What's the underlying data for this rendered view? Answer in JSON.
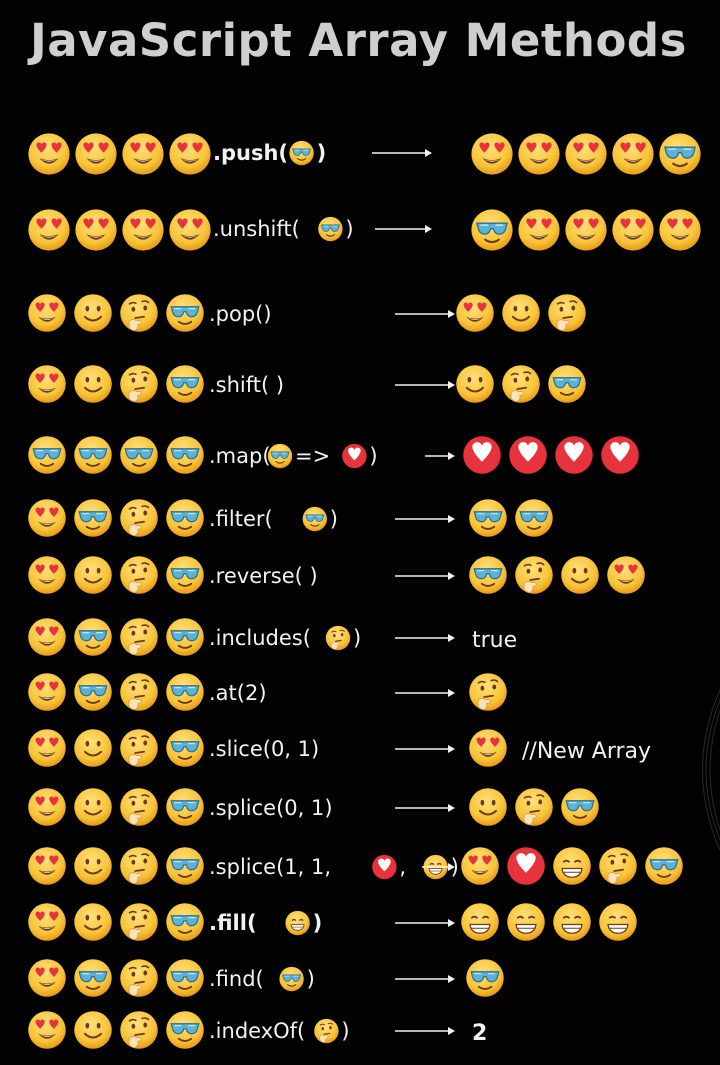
{
  "title": "JavaScript Array Methods",
  "colors": {
    "background": "#020202",
    "title": "#cfcfcf",
    "text": "#f2f2f2",
    "emoji_face": "#f8c438",
    "emoji_shade": "#e89a18",
    "heart_red": "#e8323c",
    "sunglasses": "#5ab2d6"
  },
  "emoji_legend": {
    "heart-eyes": "heart-eyes-emoji-icon",
    "smile": "smiling-emoji-icon",
    "think": "thinking-emoji-icon",
    "cool": "sunglasses-emoji-icon",
    "heart": "red-heart-icon",
    "grin": "grinning-emoji-icon"
  },
  "rows": [
    {
      "input": [
        "heart-eyes",
        "heart-eyes",
        "heart-eyes",
        "heart-eyes"
      ],
      "method": [
        {
          "t": ".push("
        },
        {
          "e": "cool"
        },
        {
          "t": ")"
        }
      ],
      "bold": true,
      "output": [
        "heart-eyes",
        "heart-eyes",
        "heart-eyes",
        "heart-eyes",
        "cool"
      ],
      "output_text": ""
    },
    {
      "input": [
        "heart-eyes",
        "heart-eyes",
        "heart-eyes",
        "heart-eyes"
      ],
      "method": [
        {
          "t": ".unshift("
        },
        {
          "e": "cool"
        },
        {
          "t": ")"
        }
      ],
      "bold": false,
      "output": [
        "cool",
        "heart-eyes",
        "heart-eyes",
        "heart-eyes",
        "heart-eyes"
      ],
      "output_text": ""
    },
    {
      "input": [
        "heart-eyes",
        "smile",
        "think",
        "cool"
      ],
      "method": [
        {
          "t": ".pop()"
        }
      ],
      "bold": false,
      "output": [
        "heart-eyes",
        "smile",
        "think"
      ],
      "output_text": ""
    },
    {
      "input": [
        "heart-eyes",
        "smile",
        "think",
        "cool"
      ],
      "method": [
        {
          "t": ".shift( )"
        }
      ],
      "bold": false,
      "output": [
        "smile",
        "think",
        "cool"
      ],
      "output_text": ""
    },
    {
      "input": [
        "cool",
        "cool",
        "cool",
        "cool"
      ],
      "method": [
        {
          "t": ".map("
        },
        {
          "e": "cool"
        },
        {
          "t": " => "
        },
        {
          "e": "heart"
        },
        {
          "t": ")"
        }
      ],
      "bold": false,
      "output": [
        "heart",
        "heart",
        "heart",
        "heart"
      ],
      "output_text": ""
    },
    {
      "input": [
        "heart-eyes",
        "cool",
        "think",
        "cool"
      ],
      "method": [
        {
          "t": ".filter("
        },
        {
          "e": "cool"
        },
        {
          "t": ")"
        }
      ],
      "bold": false,
      "output": [
        "cool",
        "cool"
      ],
      "output_text": ""
    },
    {
      "input": [
        "heart-eyes",
        "smile",
        "think",
        "cool"
      ],
      "method": [
        {
          "t": ".reverse( )"
        }
      ],
      "bold": false,
      "output": [
        "cool",
        "think",
        "smile",
        "heart-eyes"
      ],
      "output_text": ""
    },
    {
      "input": [
        "heart-eyes",
        "cool",
        "think",
        "cool"
      ],
      "method": [
        {
          "t": ".includes("
        },
        {
          "e": "think"
        },
        {
          "t": ")"
        }
      ],
      "bold": false,
      "output": [],
      "output_text": "true"
    },
    {
      "input": [
        "heart-eyes",
        "cool",
        "think",
        "cool"
      ],
      "method": [
        {
          "t": ".at(2)"
        }
      ],
      "bold": false,
      "output": [
        "think"
      ],
      "output_text": ""
    },
    {
      "input": [
        "heart-eyes",
        "smile",
        "think",
        "cool"
      ],
      "method": [
        {
          "t": ".slice(0, 1)"
        }
      ],
      "bold": false,
      "output": [
        "heart-eyes"
      ],
      "output_text": "//New Array"
    },
    {
      "input": [
        "heart-eyes",
        "smile",
        "think",
        "cool"
      ],
      "method": [
        {
          "t": ".splice(0, 1)"
        }
      ],
      "bold": false,
      "output": [
        "smile",
        "think",
        "cool"
      ],
      "output_text": ""
    },
    {
      "input": [
        "heart-eyes",
        "smile",
        "think",
        "cool"
      ],
      "method": [
        {
          "t": ".splice(1, 1, "
        },
        {
          "e": "heart"
        },
        {
          "t": ", "
        },
        {
          "e": "grin"
        },
        {
          "t": ")"
        }
      ],
      "bold": false,
      "output": [
        "heart-eyes",
        "heart",
        "grin",
        "think",
        "cool"
      ],
      "output_text": ""
    },
    {
      "input": [
        "heart-eyes",
        "smile",
        "think",
        "cool"
      ],
      "method": [
        {
          "t": ".fill("
        },
        {
          "e": "grin"
        },
        {
          "t": ")"
        }
      ],
      "bold": true,
      "output": [
        "grin",
        "grin",
        "grin",
        "grin"
      ],
      "output_text": ""
    },
    {
      "input": [
        "heart-eyes",
        "cool",
        "think",
        "cool"
      ],
      "method": [
        {
          "t": ".find("
        },
        {
          "e": "cool"
        },
        {
          "t": ")"
        }
      ],
      "bold": false,
      "output": [
        "cool"
      ],
      "output_text": ""
    },
    {
      "input": [
        "heart-eyes",
        "smile",
        "think",
        "cool"
      ],
      "method": [
        {
          "t": ".indexOf("
        },
        {
          "e": "think"
        },
        {
          "t": ")"
        }
      ],
      "bold": false,
      "output": [],
      "output_text": "2"
    }
  ]
}
